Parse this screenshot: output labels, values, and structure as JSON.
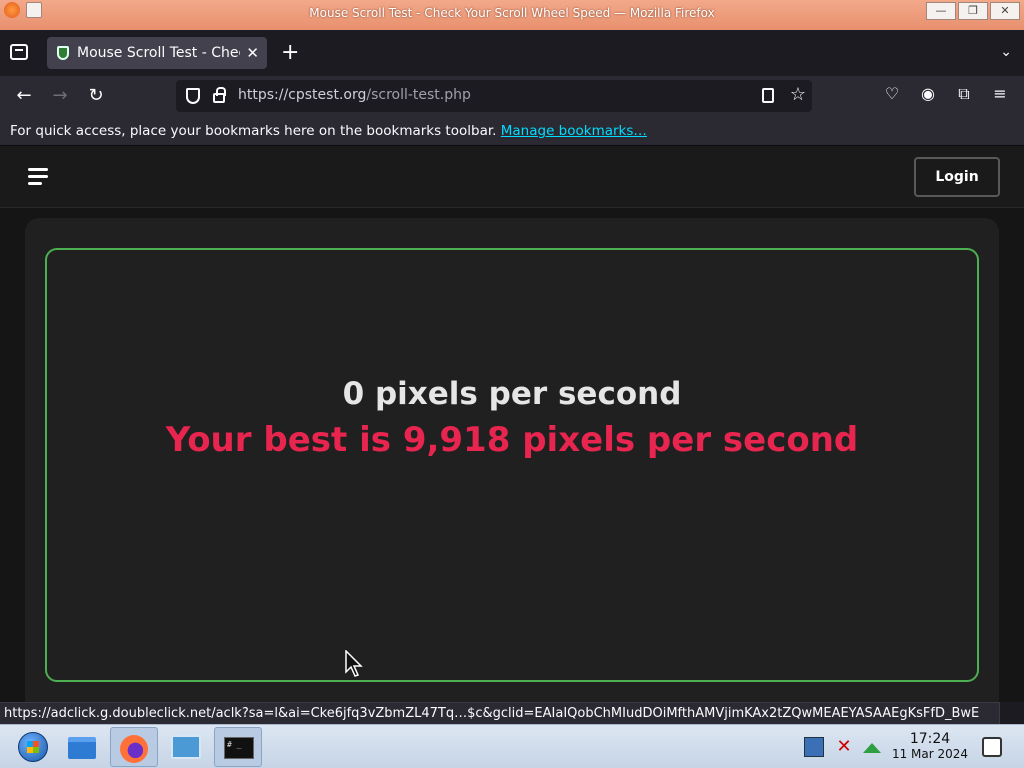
{
  "window": {
    "title": "Mouse Scroll Test - Check Your Scroll Wheel Speed — Mozilla Firefox",
    "minimize": "—",
    "maximize": "❐",
    "close": "✕"
  },
  "tabs": {
    "active_tab_label": "Mouse Scroll Test - Check Your Scroll Wheel Speed",
    "new_tab": "+",
    "list_all": "⌄"
  },
  "navbar": {
    "back": "←",
    "forward": "→",
    "reload": "↻",
    "url_base": "https://cpstest.org",
    "url_path": "/scroll-test.php",
    "star": "☆"
  },
  "bookmarks": {
    "message": "For quick access, place your bookmarks here on the bookmarks toolbar.",
    "manage_link": "Manage bookmarks…"
  },
  "site": {
    "login_label": "Login",
    "speed_text": "0 pixels per second",
    "best_text": "Your best is 9,918 pixels per second"
  },
  "status_link": "https://adclick.g.doubleclick.net/aclk?sa=l&ai=Cke6jfq3vZbmZL47Tq…$c&gclid=EAIaIQobChMIudDOiMfthAMVjimKAx2tZQwMEAEYASAAEgKsFfD_BwE",
  "taskbar": {
    "terminal_text": "# _",
    "time": "17:24",
    "date": "11 Mar 2024"
  },
  "colors": {
    "accent_green": "#4caf50",
    "best_red": "#e8254f",
    "link_cyan": "#00ddff"
  }
}
